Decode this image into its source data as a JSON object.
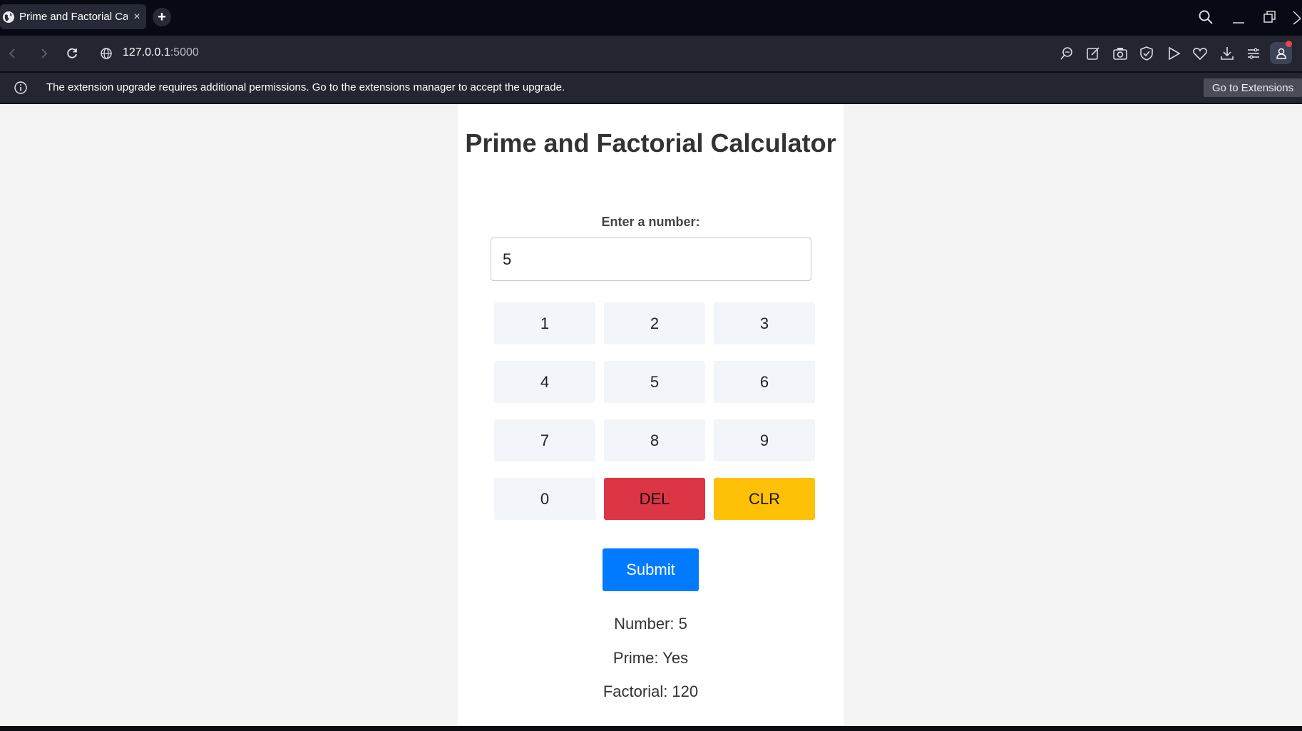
{
  "browser": {
    "tab_title": "Prime and Factorial Ca",
    "tab_close": "×",
    "new_tab": "+",
    "url_host": "127.0.0.1",
    "url_port": ":5000"
  },
  "infobar": {
    "message": "The extension upgrade requires additional permissions. Go to the extensions manager to accept the upgrade.",
    "button_label": "Go to Extensions"
  },
  "page": {
    "title": "Prime and Factorial Calculator",
    "input_label": "Enter a number:",
    "input_value": "5",
    "keys": [
      "1",
      "2",
      "3",
      "4",
      "5",
      "6",
      "7",
      "8",
      "9",
      "0",
      "DEL",
      "CLR"
    ],
    "submit_label": "Submit",
    "results": {
      "number": "Number: 5",
      "prime": "Prime: Yes",
      "factorial": "Factorial: 120"
    }
  },
  "colors": {
    "submit": "#007bff",
    "del": "#dc3545",
    "clr": "#ffc107",
    "key_bg": "#f2f5fa"
  },
  "icons": [
    "globe-icon",
    "close-icon",
    "plus-icon",
    "search-icon",
    "minimize-icon",
    "restore-icon",
    "back-icon",
    "forward-icon",
    "reload-icon",
    "site-info-icon",
    "zoom-icon",
    "edit-icon",
    "camera-icon",
    "shield-icon",
    "play-icon",
    "heart-icon",
    "download-icon",
    "menu-icon",
    "profile-icon",
    "info-icon"
  ]
}
